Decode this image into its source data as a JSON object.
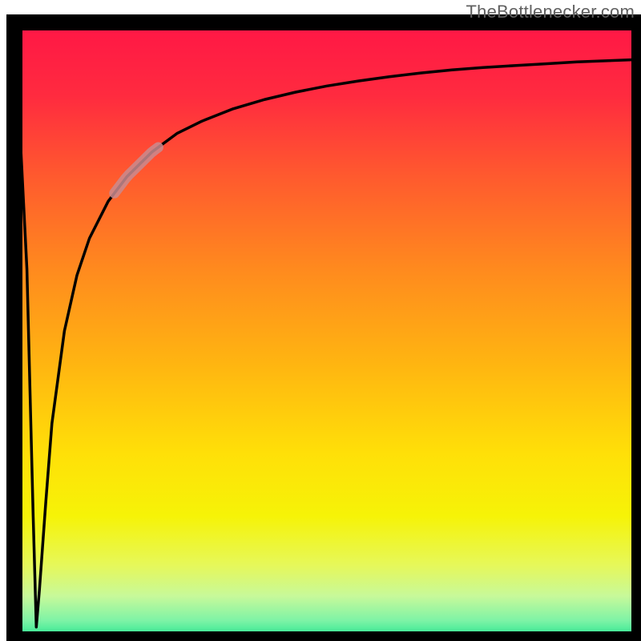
{
  "attribution": "TheBottlenecker.com",
  "chart_data": {
    "type": "line",
    "title": "",
    "xlabel": "",
    "ylabel": "",
    "xlim": [
      0,
      100
    ],
    "ylim": [
      0,
      100
    ],
    "series": [
      {
        "name": "bottleneck-curve",
        "x": [
          0,
          2,
          3,
          3.5,
          4,
          5,
          6,
          8,
          10,
          12,
          15,
          18,
          22,
          26,
          30,
          35,
          40,
          45,
          50,
          55,
          60,
          65,
          70,
          75,
          80,
          85,
          90,
          95,
          100
        ],
        "values": [
          100,
          60,
          20,
          2,
          8,
          22,
          35,
          50,
          59,
          65,
          71,
          75,
          79,
          82,
          84,
          86,
          87.5,
          88.7,
          89.7,
          90.5,
          91.2,
          91.8,
          92.3,
          92.7,
          93.0,
          93.3,
          93.6,
          93.8,
          94.0
        ]
      }
    ],
    "highlight_segment": {
      "x_start": 16,
      "x_end": 23
    },
    "background_gradient": [
      {
        "offset": 0.0,
        "color": "#ff1646"
      },
      {
        "offset": 0.12,
        "color": "#ff2b3f"
      },
      {
        "offset": 0.25,
        "color": "#ff5a2e"
      },
      {
        "offset": 0.4,
        "color": "#ff8a1e"
      },
      {
        "offset": 0.55,
        "color": "#ffb411"
      },
      {
        "offset": 0.7,
        "color": "#ffe008"
      },
      {
        "offset": 0.8,
        "color": "#f6f307"
      },
      {
        "offset": 0.88,
        "color": "#e6f85a"
      },
      {
        "offset": 0.93,
        "color": "#c7f99a"
      },
      {
        "offset": 0.97,
        "color": "#7df3a6"
      },
      {
        "offset": 1.0,
        "color": "#1fe58f"
      }
    ],
    "frame_color": "#000000",
    "curve_color": "#000000",
    "highlight_color": "#c98b8f"
  }
}
